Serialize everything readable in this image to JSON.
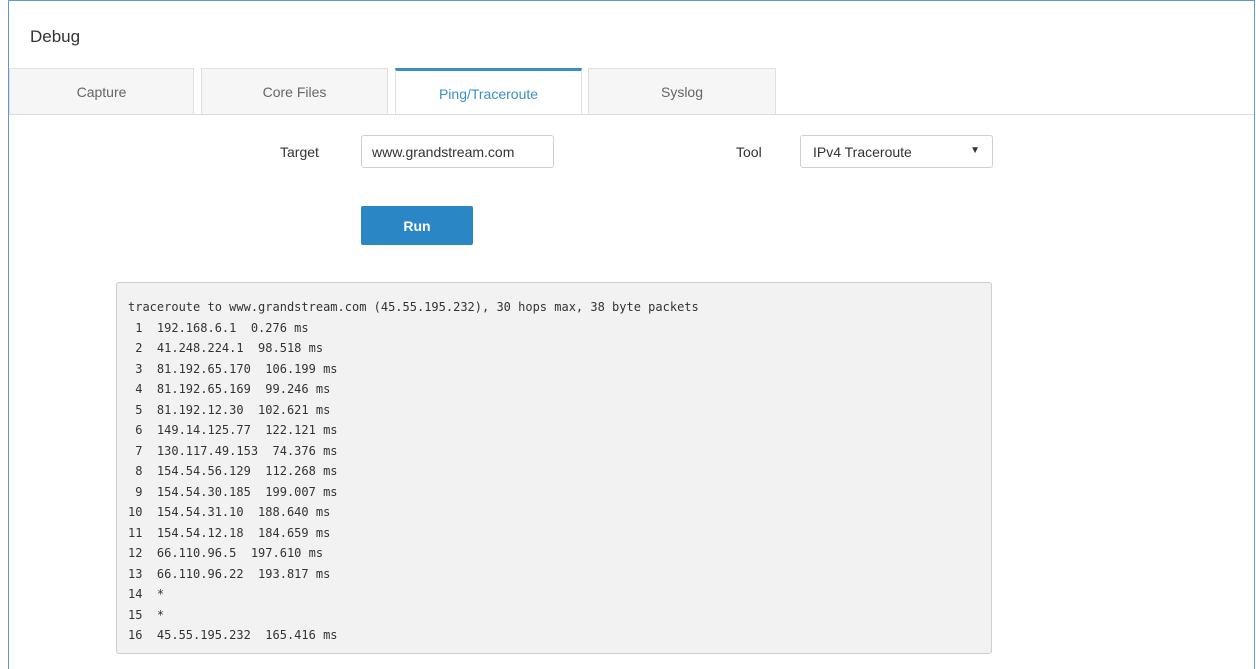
{
  "page": {
    "title": "Debug"
  },
  "tabs": [
    {
      "label": "Capture",
      "active": false
    },
    {
      "label": "Core Files",
      "active": false
    },
    {
      "label": "Ping/Traceroute",
      "active": true
    },
    {
      "label": "Syslog",
      "active": false
    }
  ],
  "form": {
    "target_label": "Target",
    "target_value": "www.grandstream.com",
    "tool_label": "Tool",
    "tool_value": "IPv4 Traceroute",
    "run_label": "Run"
  },
  "output": {
    "lines": [
      "traceroute to www.grandstream.com (45.55.195.232), 30 hops max, 38 byte packets",
      " 1  192.168.6.1  0.276 ms",
      " 2  41.248.224.1  98.518 ms",
      " 3  81.192.65.170  106.199 ms",
      " 4  81.192.65.169  99.246 ms",
      " 5  81.192.12.30  102.621 ms",
      " 6  149.14.125.77  122.121 ms",
      " 7  130.117.49.153  74.376 ms",
      " 8  154.54.56.129  112.268 ms",
      " 9  154.54.30.185  199.007 ms",
      "10  154.54.31.10  188.640 ms",
      "11  154.54.12.18  184.659 ms",
      "12  66.110.96.5  197.610 ms",
      "13  66.110.96.22  193.817 ms",
      "14  *",
      "15  *",
      "16  45.55.195.232  165.416 ms"
    ]
  },
  "colors": {
    "accent": "#3b8fc7",
    "button": "#2b86c5",
    "panel_border": "#5b9bd5",
    "output_bg": "#f2f2f2"
  }
}
